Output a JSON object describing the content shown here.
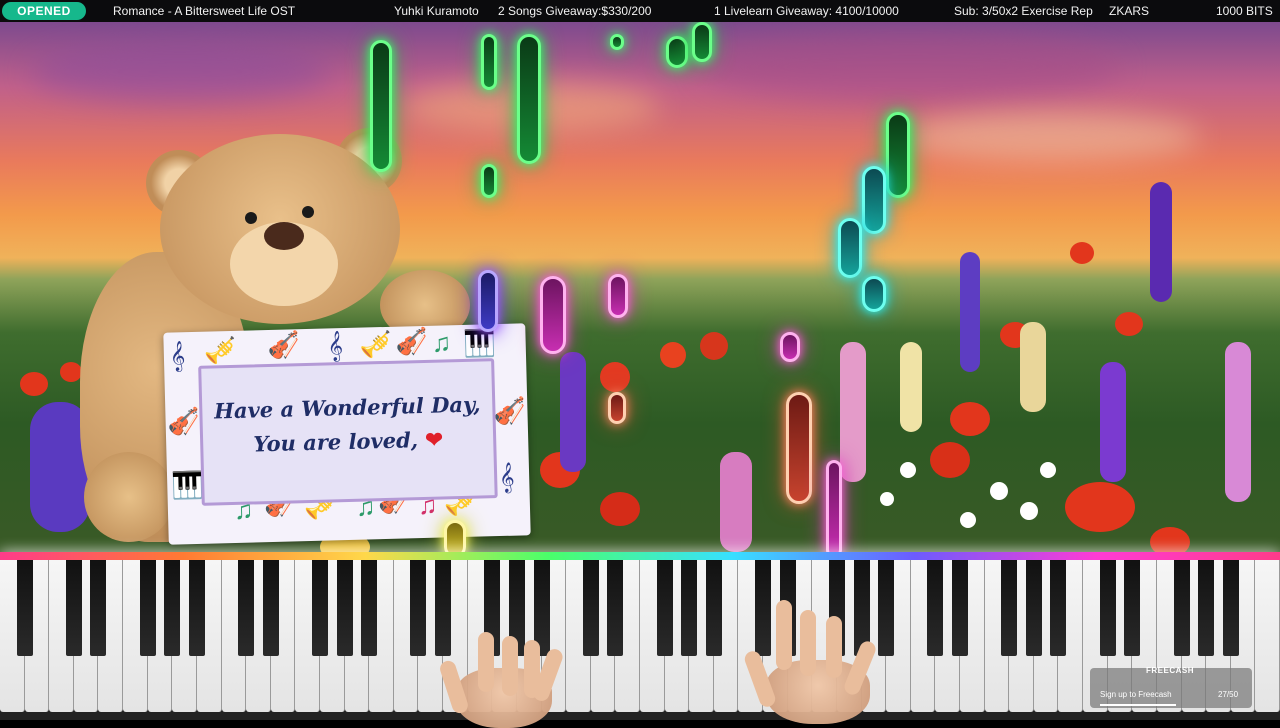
{
  "stream_header": {
    "badge": "OPENED",
    "song": "Romance - A Bittersweet Life OST",
    "artist": "Yuhki Kuramoto",
    "songs_giveaway": "2 Songs Giveaway:$330/200",
    "livelearn_giveaway": "1 Livelearn Giveaway: 4100/10000",
    "sub_goal": "Sub: 3/50x2 Exercise Rep",
    "channel": "ZKARS",
    "bits": "1000 BITS"
  },
  "sign": {
    "line1": "Have a Wonderful Day,",
    "line2": "You are loved, ",
    "heart": "❤"
  },
  "freecash_overlay": {
    "brand": "FREECASH",
    "cta": "Sign up to Freecash",
    "progress": "27/50"
  },
  "colors": {
    "badge_green": "#16b88c",
    "note_green": "#6bff8a",
    "note_cyan": "#6dfff0",
    "note_blue": "#b8a6ff",
    "note_pink": "#ffb2ef"
  }
}
